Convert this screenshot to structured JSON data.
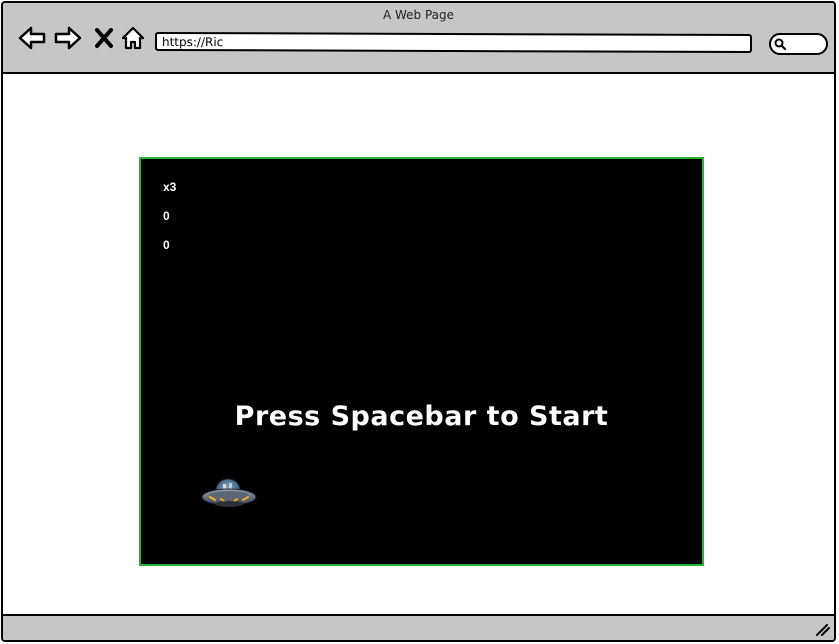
{
  "window": {
    "title": "A Web Page"
  },
  "toolbar": {
    "back_icon": "back-arrow-icon",
    "forward_icon": "forward-arrow-icon",
    "stop_icon": "close-icon",
    "home_icon": "home-icon",
    "address": "https://Ric",
    "search_icon": "search-icon"
  },
  "game": {
    "lives": "x3",
    "score": "0",
    "high_score": "0",
    "start_message": "Press Spacebar to Start",
    "player_sprite": "ufo-spaceship-icon",
    "colors": {
      "border": "#27b233",
      "background": "#000000",
      "text": "#ffffff"
    }
  },
  "statusbar": {
    "resize_icon": "resize-grip-icon"
  }
}
